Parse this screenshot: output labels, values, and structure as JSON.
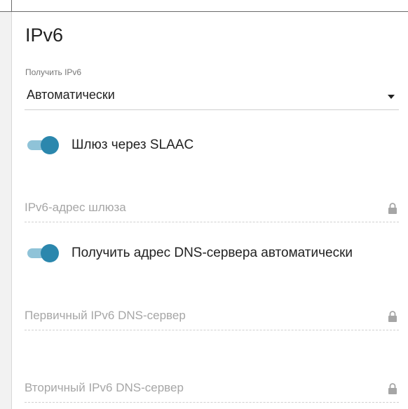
{
  "section": {
    "title": "IPv6"
  },
  "get_ipv6": {
    "label": "Получить IPv6",
    "value": "Автоматически"
  },
  "slaac_toggle": {
    "label": "Шлюз через SLAAC",
    "enabled": true
  },
  "gateway_field": {
    "placeholder": "IPv6-адрес шлюза",
    "locked": true
  },
  "dns_auto_toggle": {
    "label": "Получить адрес DNS-сервера автоматически",
    "enabled": true
  },
  "primary_dns_field": {
    "placeholder": "Первичный IPv6 DNS-сервер",
    "locked": true
  },
  "secondary_dns_field": {
    "placeholder": "Вторичный IPv6 DNS-сервер",
    "locked": true
  },
  "colors": {
    "accent": "#2b87ad",
    "accent_light": "#8fc3d8",
    "placeholder": "#a6a6a6"
  }
}
